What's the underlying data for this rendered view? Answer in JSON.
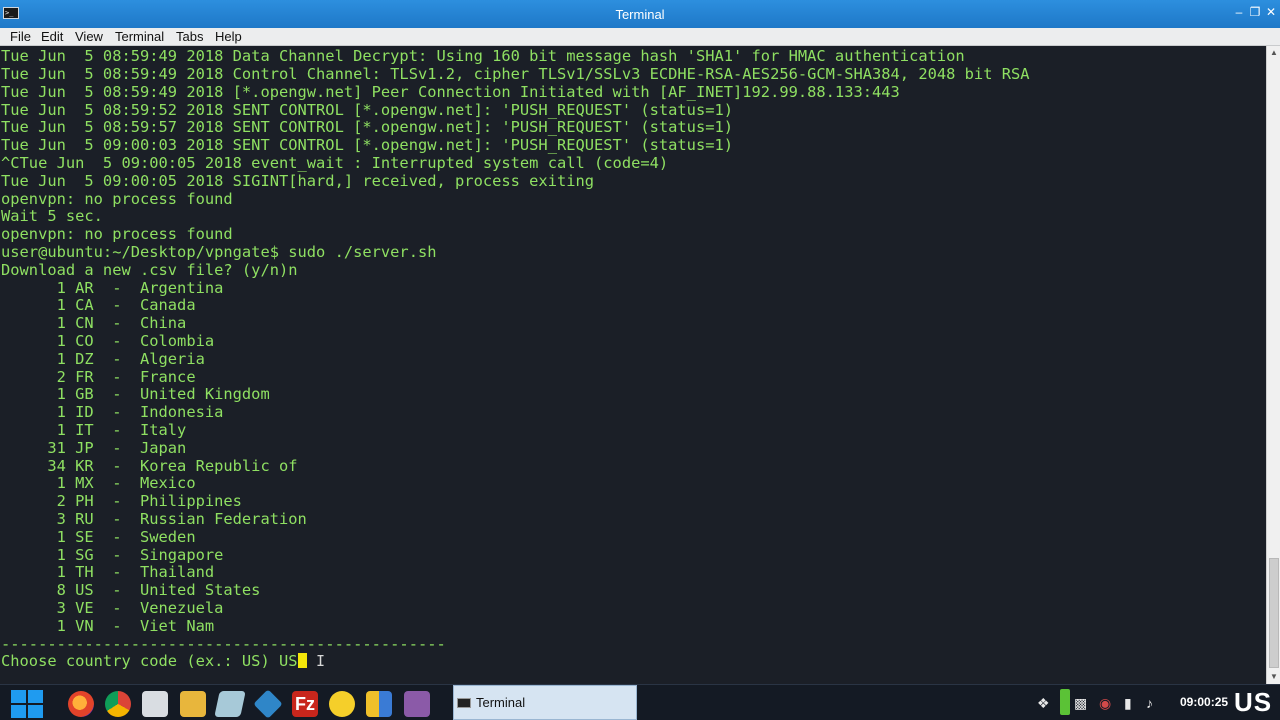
{
  "window": {
    "title": "Terminal"
  },
  "menu": [
    "File",
    "Edit",
    "View",
    "Terminal",
    "Tabs",
    "Help"
  ],
  "terminal": {
    "lines": [
      "Tue Jun  5 08:59:49 2018 Data Channel Decrypt: Using 160 bit message hash 'SHA1' for HMAC authentication",
      "Tue Jun  5 08:59:49 2018 Control Channel: TLSv1.2, cipher TLSv1/SSLv3 ECDHE-RSA-AES256-GCM-SHA384, 2048 bit RSA",
      "Tue Jun  5 08:59:49 2018 [*.opengw.net] Peer Connection Initiated with [AF_INET]192.99.88.133:443",
      "Tue Jun  5 08:59:52 2018 SENT CONTROL [*.opengw.net]: 'PUSH_REQUEST' (status=1)",
      "Tue Jun  5 08:59:57 2018 SENT CONTROL [*.opengw.net]: 'PUSH_REQUEST' (status=1)",
      "Tue Jun  5 09:00:03 2018 SENT CONTROL [*.opengw.net]: 'PUSH_REQUEST' (status=1)",
      "^CTue Jun  5 09:00:05 2018 event_wait : Interrupted system call (code=4)",
      "Tue Jun  5 09:00:05 2018 SIGINT[hard,] received, process exiting",
      "openvpn: no process found",
      "Wait 5 sec.",
      "openvpn: no process found",
      "user@ubuntu:~/Desktop/vpngate$ sudo ./server.sh",
      "Download a new .csv file? (y/n)n",
      "      1 AR  -  Argentina",
      "      1 CA  -  Canada",
      "      1 CN  -  China",
      "      1 CO  -  Colombia",
      "      1 DZ  -  Algeria",
      "      2 FR  -  France",
      "      1 GB  -  United Kingdom",
      "      1 ID  -  Indonesia",
      "      1 IT  -  Italy",
      "     31 JP  -  Japan",
      "     34 KR  -  Korea Republic of",
      "      1 MX  -  Mexico",
      "      2 PH  -  Philippines",
      "      3 RU  -  Russian Federation",
      "      1 SE  -  Sweden",
      "      1 SG  -  Singapore",
      "      1 TH  -  Thailand",
      "      8 US  -  United States",
      "      3 VE  -  Venezuela",
      "      1 VN  -  Viet Nam",
      "------------------------------------------------"
    ],
    "prompt": "Choose country code (ex.: US) ",
    "input_value": "US"
  },
  "taskbar": {
    "active_task": "Terminal",
    "clock": "09:00:25",
    "language": "US"
  },
  "colors": {
    "terminal_text": "#8fe062",
    "terminal_bg": "#1b1f27",
    "cursor": "#f4e60a",
    "titlebar": "#1e78c8"
  }
}
